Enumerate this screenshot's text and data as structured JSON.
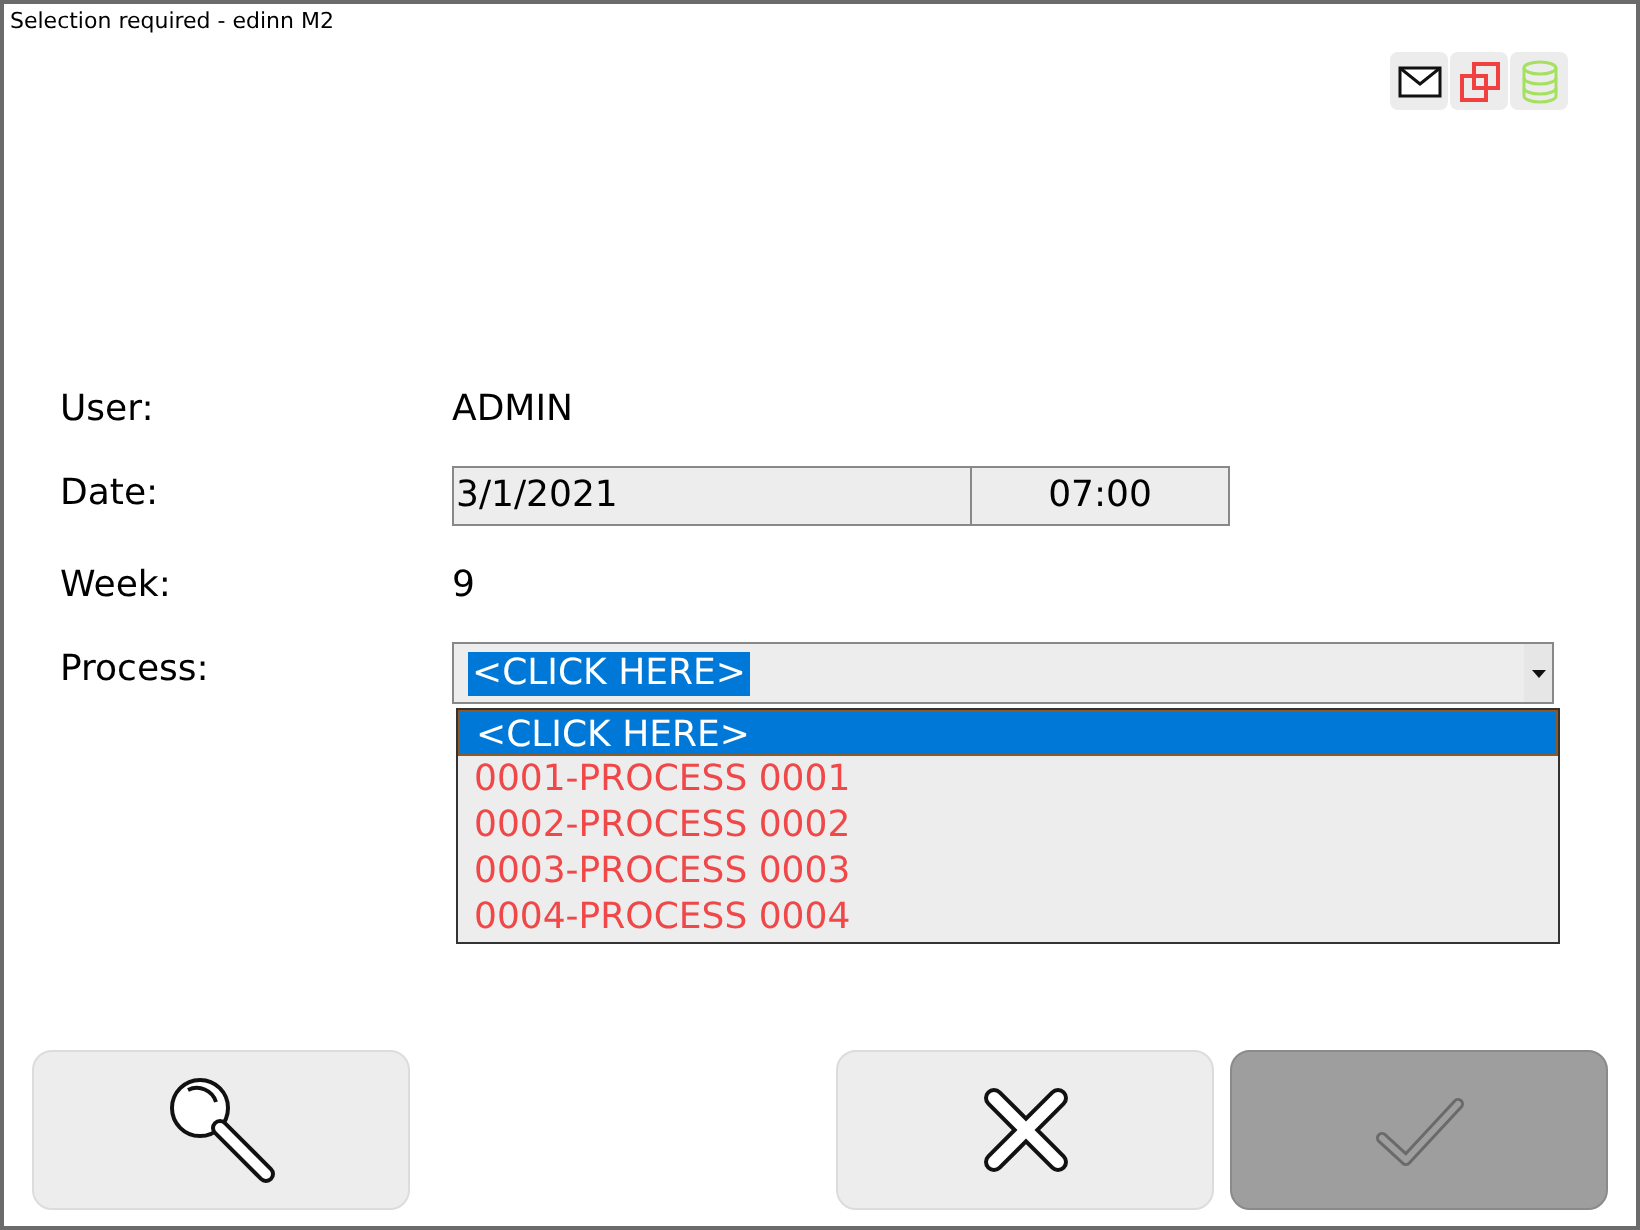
{
  "window": {
    "title": "Selection required - edinn M2"
  },
  "form": {
    "user": {
      "label": "User:",
      "value": "ADMIN"
    },
    "date": {
      "label": "Date:",
      "date": "3/1/2021",
      "time": "07:00"
    },
    "week": {
      "label": "Week:",
      "value": "9"
    },
    "process": {
      "label": "Process:",
      "value": "<CLICK HERE>",
      "expanded": true,
      "options": [
        {
          "label": "<CLICK HERE>",
          "selected": true
        },
        {
          "label": "0001-PROCESS 0001",
          "selected": false
        },
        {
          "label": "0002-PROCESS 0002",
          "selected": false
        },
        {
          "label": "0003-PROCESS 0003",
          "selected": false
        },
        {
          "label": "0004-PROCESS 0004",
          "selected": false
        }
      ]
    }
  },
  "buttons": [
    {
      "kind": "search",
      "disabled": false
    },
    {
      "kind": "cancel",
      "disabled": false
    },
    {
      "kind": "accept",
      "disabled": true
    }
  ]
}
